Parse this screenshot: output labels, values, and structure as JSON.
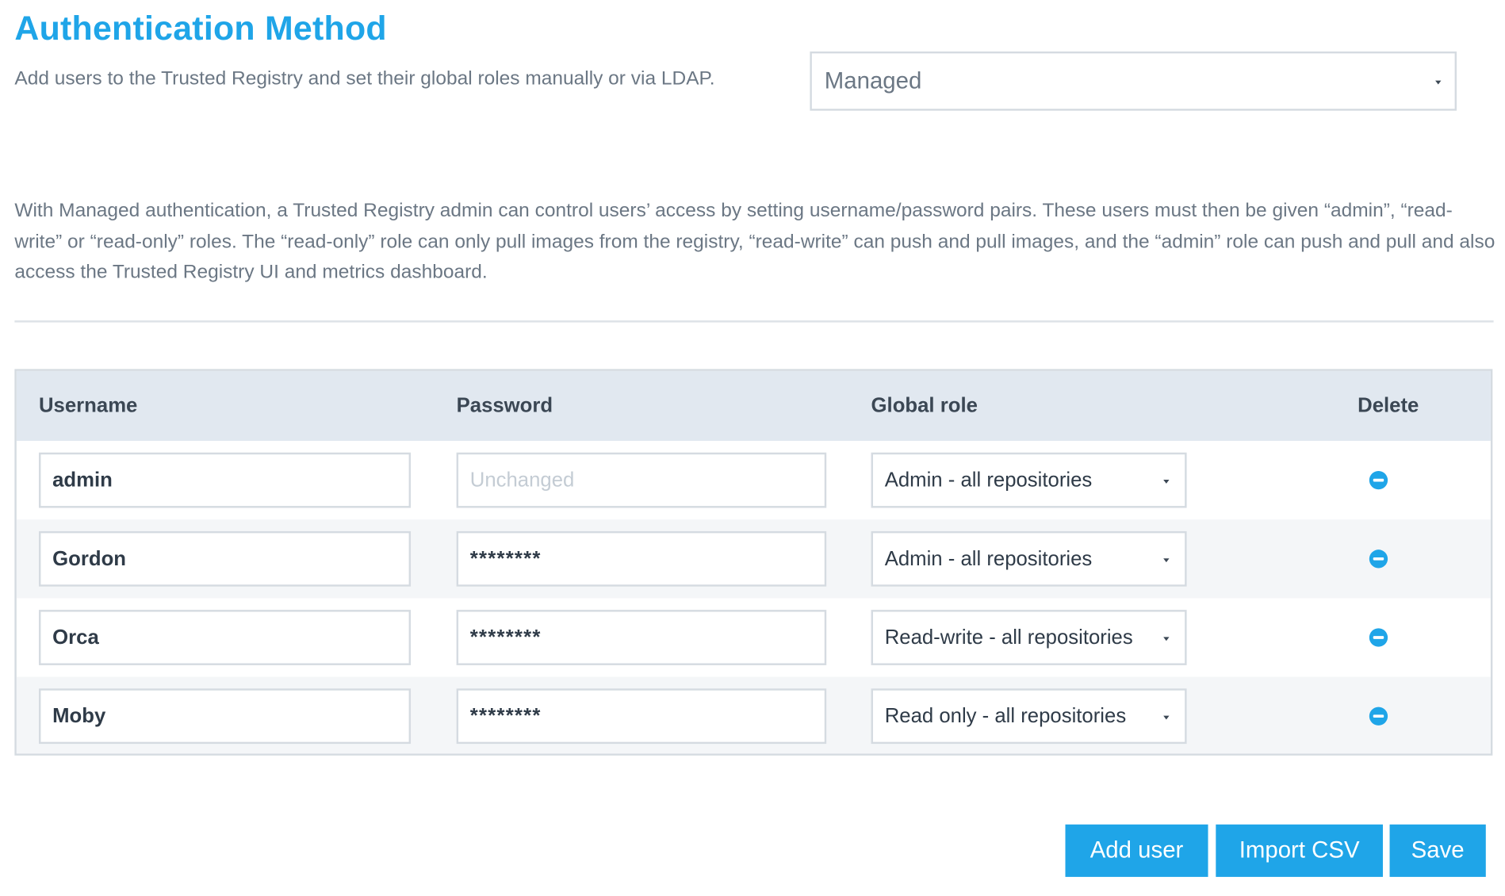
{
  "header": {
    "title": "Authentication Method",
    "subtitle": "Add users to the Trusted Registry and set their global roles manually or via LDAP."
  },
  "auth_method": {
    "selected": "Managed"
  },
  "description": "With Managed authentication, a Trusted Registry admin can control users’ access by setting username/password pairs. These users must then be given “admin”, “read-write” or “read-only” roles. The “read-only” role can only pull images from the registry, “read-write” can push and pull images, and the “admin” role can push and pull and also access the Trusted Registry UI and metrics dashboard.",
  "table": {
    "headers": {
      "username": "Username",
      "password": "Password",
      "global_role": "Global role",
      "delete": "Delete"
    },
    "rows": [
      {
        "username": "admin",
        "password": "",
        "password_placeholder": "Unchanged",
        "role": "Admin - all repositories"
      },
      {
        "username": "Gordon",
        "password": "********",
        "role": "Admin - all repositories"
      },
      {
        "username": "Orca",
        "password": "********",
        "role": "Read-write - all repositories"
      },
      {
        "username": "Moby",
        "password": "********",
        "role": "Read only - all repositories"
      }
    ]
  },
  "actions": {
    "add_user": "Add user",
    "import_csv": "Import CSV",
    "save": "Save"
  },
  "colors": {
    "accent": "#1fa5e8",
    "header_bg": "#e1e8f0",
    "text": "#3b4754"
  },
  "icons": {
    "dropdown": "chevron-down-icon",
    "delete": "minus-circle-icon"
  }
}
